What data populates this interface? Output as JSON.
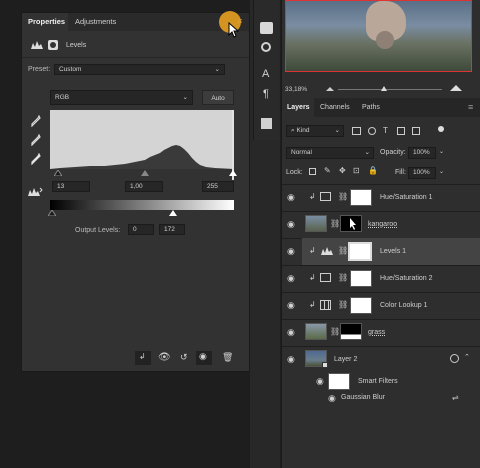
{
  "properties": {
    "tabs": [
      "Properties",
      "Adjustments"
    ],
    "panel_name": "Levels",
    "preset_label": "Preset:",
    "preset_value": "Custom",
    "channel": "RGB",
    "auto_label": "Auto",
    "input_levels": {
      "black": "13",
      "gamma": "1,00",
      "white": "255"
    },
    "output_label": "Output Levels:",
    "output_levels": {
      "black": "0",
      "white": "172"
    }
  },
  "navigator": {
    "zoom": "33,18%"
  },
  "layers_panel": {
    "tabs": [
      "Layers",
      "Channels",
      "Paths"
    ],
    "filter_label": "Kind",
    "blend_mode": "Normal",
    "opacity_label": "Opacity:",
    "opacity_value": "100%",
    "lock_label": "Lock:",
    "fill_label": "Fill:",
    "fill_value": "100%",
    "layers": [
      {
        "name": "Hue/Saturation 1"
      },
      {
        "name": "kangaroo"
      },
      {
        "name": "Levels 1"
      },
      {
        "name": "Hue/Saturation 2"
      },
      {
        "name": "Color Lookup 1"
      },
      {
        "name": "grass"
      },
      {
        "name": "Layer 2"
      }
    ],
    "smart_filters": "Smart Filters",
    "gaussian_blur": "Gaussian Blur"
  },
  "colors": {
    "accent": "#e6a020",
    "panel": "#323232",
    "selected_layer": "#444444"
  }
}
